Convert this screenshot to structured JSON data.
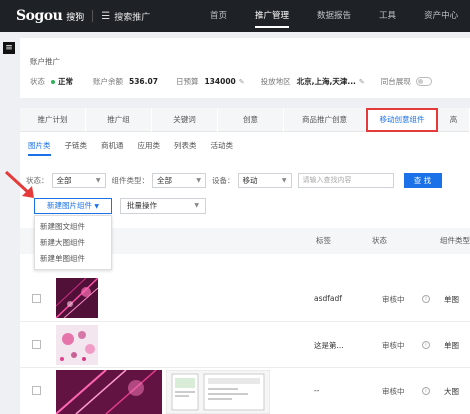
{
  "header": {
    "logo": "Sogou",
    "logo_sub": "搜狗",
    "product": "搜索推广",
    "nav": [
      "首页",
      "推广管理",
      "数据报告",
      "工具",
      "资产中心"
    ]
  },
  "sidebar_toggle": "≡",
  "account": {
    "title": "账户推广",
    "status_label": "状态",
    "status_value": "正常",
    "balance_label": "账户余额",
    "balance_value": "536.07",
    "budget_label": "日预算",
    "budget_value": "134000",
    "region_label": "投放地区",
    "region_value": "北京,上海,天津...",
    "same_show_label": "同台展现"
  },
  "tabs": [
    "推广计划",
    "推广组",
    "关键词",
    "创意",
    "商品推广创意",
    "移动创意组件",
    "高"
  ],
  "subtabs": [
    "图片类",
    "子链类",
    "商机通",
    "应用类",
    "列表类",
    "活动类"
  ],
  "filters": {
    "status_label": "状态：",
    "status_value": "全部",
    "type_label": "组件类型：",
    "type_value": "全部",
    "device_label": "设备：",
    "device_value": "移动",
    "search_placeholder": "请输入查找内容",
    "search_button": "查 找"
  },
  "actions": {
    "new_button": "新建图片组件",
    "batch_button": "批量操作"
  },
  "dropdown": [
    "新建图文组件",
    "新建大图组件",
    "新建单图组件"
  ],
  "table": {
    "headers": [
      "标签",
      "状态",
      "组件类型"
    ],
    "rows": [
      {
        "tag": "asdfadf",
        "status": "审核中",
        "type": "单图"
      },
      {
        "tag": "这是第...",
        "status": "审核中",
        "type": "单图"
      },
      {
        "tag": "--",
        "status": "审核中",
        "type": "大图"
      }
    ]
  },
  "colors": {
    "accent": "#1b72e8",
    "highlight_border": "#e53a3a",
    "topbar": "#1e2126",
    "status_ok": "#2fb35a"
  }
}
